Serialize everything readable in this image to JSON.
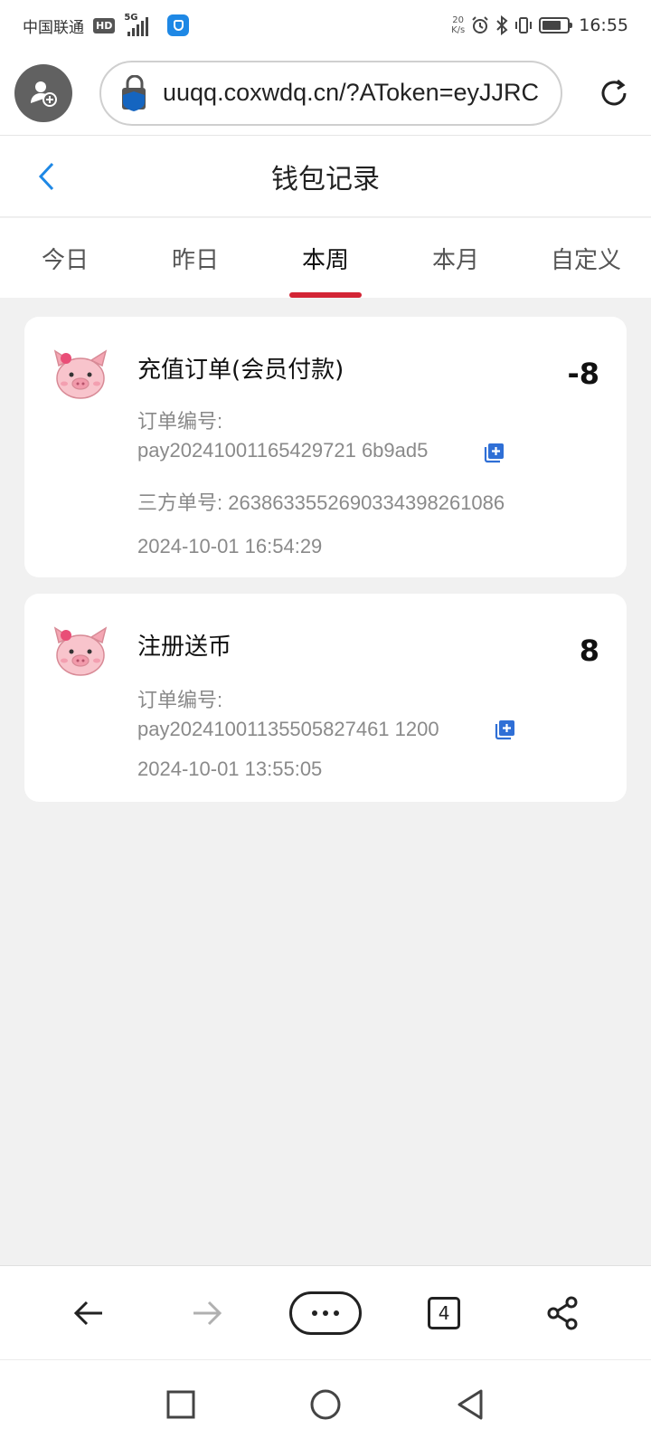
{
  "status_bar": {
    "carrier": "中国联通",
    "hd_badge": "HD",
    "network": "5G",
    "speed_value": "20",
    "speed_unit": "K/s",
    "battery_level": 0.75,
    "time": "16:55"
  },
  "browser": {
    "url": "uuqq.coxwdq.cn/?AToken=eyJJRC",
    "icons": {
      "account": "account-add-icon",
      "secure": "lock-shield-icon",
      "reload": "reload-icon"
    }
  },
  "page": {
    "title": "钱包记录",
    "back_icon": "back-chevron-icon"
  },
  "tabs": [
    {
      "label": "今日",
      "active": false
    },
    {
      "label": "昨日",
      "active": false
    },
    {
      "label": "本周",
      "active": true
    },
    {
      "label": "本月",
      "active": false
    },
    {
      "label": "自定义",
      "active": false
    }
  ],
  "records": [
    {
      "title": "充值订单(会员付款)",
      "amount": "-8",
      "order_label": "订单编号:",
      "order_no": "pay20241001165429721 6b9ad5",
      "third_party_label": "三方单号:",
      "third_party_no": "2638633552690334398261086",
      "datetime": "2024-10-01 16:54:29"
    },
    {
      "title": "注册送币",
      "amount": "8",
      "order_label": "订单编号:",
      "order_no": "pay20241001135505827461 1200",
      "datetime": "2024-10-01 13:55:05"
    }
  ],
  "bottom_nav": {
    "tab_count": "4"
  },
  "accent_color": "#d32535",
  "link_color": "#1e88e5"
}
